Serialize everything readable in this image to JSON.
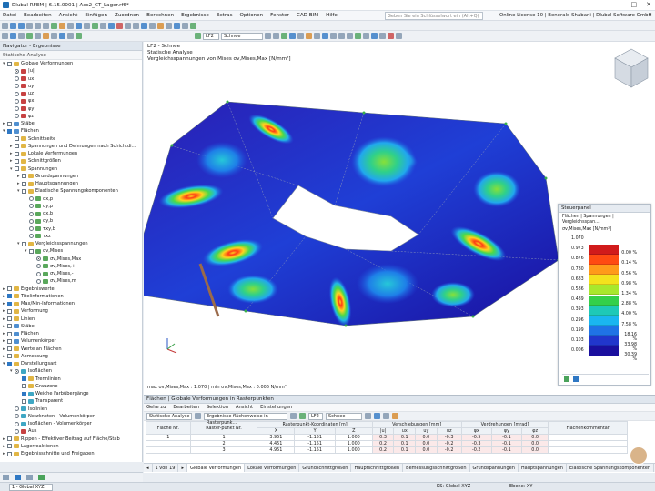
{
  "window": {
    "title": "Dlubal RFEM | 6.15.0001 | Axs2_CT_Lager.rf6*"
  },
  "menu": [
    "Datei",
    "Bearbeiten",
    "Ansicht",
    "Einfügen",
    "Zuordnen",
    "Berechnen",
    "Ergebnisse",
    "Extras",
    "Optionen",
    "Fenster",
    "CAD-BIM",
    "Hilfe"
  ],
  "search": {
    "placeholder": "Geben Sie ein Schlüsselwort ein (Alt+Q)"
  },
  "license": "Online License 10 | Benerald Shabani | Dlubal Software GmbH",
  "toolbar": {
    "loadcase_code": "LF2",
    "loadcase_name": "Schnee"
  },
  "navigator": {
    "title": "Navigator - Ergebnisse",
    "subtitle": "Statische Analyse",
    "items": [
      {
        "label": "Globale Verformungen",
        "lvl": 0,
        "ex": "▾",
        "ctl": "cb",
        "on": false,
        "ic": "y"
      },
      {
        "label": "|u|",
        "lvl": 1,
        "ex": "",
        "ctl": "rb",
        "on": true,
        "ic": "r"
      },
      {
        "label": "ux",
        "lvl": 1,
        "ex": "",
        "ctl": "rb",
        "on": false,
        "ic": "r"
      },
      {
        "label": "uy",
        "lvl": 1,
        "ex": "",
        "ctl": "rb",
        "on": false,
        "ic": "r"
      },
      {
        "label": "uz",
        "lvl": 1,
        "ex": "",
        "ctl": "rb",
        "on": false,
        "ic": "r"
      },
      {
        "label": "φx",
        "lvl": 1,
        "ex": "",
        "ctl": "rb",
        "on": false,
        "ic": "r"
      },
      {
        "label": "φy",
        "lvl": 1,
        "ex": "",
        "ctl": "rb",
        "on": false,
        "ic": "r"
      },
      {
        "label": "φz",
        "lvl": 1,
        "ex": "",
        "ctl": "rb",
        "on": false,
        "ic": "r"
      },
      {
        "label": "Stäbe",
        "lvl": 0,
        "ex": "▸",
        "ctl": "cb",
        "on": false,
        "ic": "b"
      },
      {
        "label": "Flächen",
        "lvl": 0,
        "ex": "▾",
        "ctl": "cb",
        "on": true,
        "ic": "b"
      },
      {
        "label": "Schnittseite",
        "lvl": 1,
        "ex": "",
        "ctl": "cb",
        "on": false,
        "ic": "y"
      },
      {
        "label": "Spannungen und Dehnungen nach Schichtdi...",
        "lvl": 1,
        "ex": "▸",
        "ctl": "cb",
        "on": false,
        "ic": "y"
      },
      {
        "label": "Lokale Verformungen",
        "lvl": 1,
        "ex": "▸",
        "ctl": "cb",
        "on": false,
        "ic": "y"
      },
      {
        "label": "Schnittgrößen",
        "lvl": 1,
        "ex": "▸",
        "ctl": "cb",
        "on": false,
        "ic": "y"
      },
      {
        "label": "Spannungen",
        "lvl": 1,
        "ex": "▾",
        "ctl": "cb",
        "on": false,
        "ic": "y"
      },
      {
        "label": "Grundspannungen",
        "lvl": 2,
        "ex": "▸",
        "ctl": "cb",
        "on": false,
        "ic": "y"
      },
      {
        "label": "Hauptspannungen",
        "lvl": 2,
        "ex": "▸",
        "ctl": "cb",
        "on": false,
        "ic": "y"
      },
      {
        "label": "Elastische Spannungskomponenten",
        "lvl": 2,
        "ex": "▾",
        "ctl": "cb",
        "on": false,
        "ic": "y"
      },
      {
        "label": "σx,p",
        "lvl": 3,
        "ex": "",
        "ctl": "rb",
        "on": false,
        "ic": "g"
      },
      {
        "label": "σy,p",
        "lvl": 3,
        "ex": "",
        "ctl": "rb",
        "on": false,
        "ic": "g"
      },
      {
        "label": "σx,b",
        "lvl": 3,
        "ex": "",
        "ctl": "rb",
        "on": false,
        "ic": "g"
      },
      {
        "label": "σy,b",
        "lvl": 3,
        "ex": "",
        "ctl": "rb",
        "on": false,
        "ic": "g"
      },
      {
        "label": "τxy,b",
        "lvl": 3,
        "ex": "",
        "ctl": "rb",
        "on": false,
        "ic": "g"
      },
      {
        "label": "τxz",
        "lvl": 3,
        "ex": "",
        "ctl": "rb",
        "on": false,
        "ic": "g"
      },
      {
        "label": "Vergleichsspannungen",
        "lvl": 2,
        "ex": "▾",
        "ctl": "cb",
        "on": false,
        "ic": "y"
      },
      {
        "label": "σv,Mises",
        "lvl": 3,
        "ex": "▾",
        "ctl": "cb",
        "on": false,
        "ic": "g"
      },
      {
        "label": "σv,Mises,Max",
        "lvl": 4,
        "ex": "",
        "ctl": "rb",
        "on": true,
        "ic": "g"
      },
      {
        "label": "σv,Mises,+",
        "lvl": 4,
        "ex": "",
        "ctl": "rb",
        "on": false,
        "ic": "g"
      },
      {
        "label": "σv,Mises,-",
        "lvl": 4,
        "ex": "",
        "ctl": "rb",
        "on": false,
        "ic": "g"
      },
      {
        "label": "σv,Mises,m",
        "lvl": 4,
        "ex": "",
        "ctl": "rb",
        "on": false,
        "ic": "g"
      },
      {
        "label": "Ergebniswerte",
        "lvl": 0,
        "ex": "▸",
        "ctl": "cb",
        "on": false,
        "ic": "y"
      },
      {
        "label": "Titelinformationen",
        "lvl": 0,
        "ex": "▸",
        "ctl": "cb",
        "on": true,
        "ic": "y"
      },
      {
        "label": "Max/Min-Informationen",
        "lvl": 0,
        "ex": "▸",
        "ctl": "cb",
        "on": true,
        "ic": "y"
      },
      {
        "label": "Verformung",
        "lvl": 0,
        "ex": "▸",
        "ctl": "cb",
        "on": false,
        "ic": "y"
      },
      {
        "label": "Linien",
        "lvl": 0,
        "ex": "▸",
        "ctl": "cb",
        "on": false,
        "ic": "y"
      },
      {
        "label": "Stäbe",
        "lvl": 0,
        "ex": "▸",
        "ctl": "cb",
        "on": false,
        "ic": "b"
      },
      {
        "label": "Flächen",
        "lvl": 0,
        "ex": "▸",
        "ctl": "cb",
        "on": false,
        "ic": "b"
      },
      {
        "label": "Volumenkörper",
        "lvl": 0,
        "ex": "▸",
        "ctl": "cb",
        "on": false,
        "ic": "b"
      },
      {
        "label": "Werte an Flächen",
        "lvl": 0,
        "ex": "▸",
        "ctl": "cb",
        "on": false,
        "ic": "y"
      },
      {
        "label": "Abmessung",
        "lvl": 0,
        "ex": "▸",
        "ctl": "cb",
        "on": false,
        "ic": "y"
      },
      {
        "label": "Darstellungsart",
        "lvl": 0,
        "ex": "▾",
        "ctl": "cb",
        "on": true,
        "ic": "y"
      },
      {
        "label": "Isoflächen",
        "lvl": 1,
        "ex": "▾",
        "ctl": "rb",
        "on": true,
        "ic": "c"
      },
      {
        "label": "Trennlinien",
        "lvl": 2,
        "ex": "",
        "ctl": "cb",
        "on": true,
        "ic": "y"
      },
      {
        "label": "Grauzone",
        "lvl": 2,
        "ex": "",
        "ctl": "cb",
        "on": false,
        "ic": "y"
      },
      {
        "label": "Weiche Farbübergänge",
        "lvl": 2,
        "ex": "",
        "ctl": "cb",
        "on": true,
        "ic": "c"
      },
      {
        "label": "Transparent",
        "lvl": 2,
        "ex": "",
        "ctl": "cb",
        "on": false,
        "ic": "c"
      },
      {
        "label": "Isolinien",
        "lvl": 1,
        "ex": "",
        "ctl": "rb",
        "on": false,
        "ic": "c"
      },
      {
        "label": "Netzknoten - Volumenkörper",
        "lvl": 1,
        "ex": "",
        "ctl": "rb",
        "on": false,
        "ic": "c"
      },
      {
        "label": "Isoflächen - Volumenkörper",
        "lvl": 1,
        "ex": "",
        "ctl": "rb",
        "on": false,
        "ic": "c"
      },
      {
        "label": "Aus",
        "lvl": 1,
        "ex": "",
        "ctl": "rb",
        "on": false,
        "ic": "r"
      },
      {
        "label": "Rippen - Effektiver Beitrag auf Fläche/Stab",
        "lvl": 0,
        "ex": "▸",
        "ctl": "cb",
        "on": false,
        "ic": "y"
      },
      {
        "label": "Lagerreaktionen",
        "lvl": 0,
        "ex": "▸",
        "ctl": "cb",
        "on": false,
        "ic": "y"
      },
      {
        "label": "Ergebnisschnitte und Freigaben",
        "lvl": 0,
        "ex": "▸",
        "ctl": "cb",
        "on": false,
        "ic": "y"
      }
    ]
  },
  "nav_bottom": {
    "view_select": "1 - Global XYZ"
  },
  "view": {
    "line1": "LF2 - Schnee",
    "line2": "Statische Analyse",
    "line3": "Vergleichsspannungen von Mises σv,Mises,Max [N/mm²]",
    "footer": "max σv,Mises,Max : 1.070 | min σv,Mises,Max : 0.006 N/mm²"
  },
  "control_panel": {
    "title": "Steuerpanel",
    "subtitle": "Flächen | Spannungen | Vergleichsspan...",
    "unit": "σv,Mises,Max [N/mm²]",
    "legend": [
      {
        "value": "1.070",
        "color": "#7a0a0a",
        "pct": ""
      },
      {
        "value": "0.973",
        "color": "#d11b1b",
        "pct": "0.00 %"
      },
      {
        "value": "0.876",
        "color": "#ff4a12",
        "pct": "0.14 %"
      },
      {
        "value": "0.780",
        "color": "#ff9a1a",
        "pct": "0.56 %"
      },
      {
        "value": "0.683",
        "color": "#f3e21d",
        "pct": "0.98 %"
      },
      {
        "value": "0.586",
        "color": "#a7e82d",
        "pct": "1.34 %"
      },
      {
        "value": "0.489",
        "color": "#33d04a",
        "pct": "2.88 %"
      },
      {
        "value": "0.393",
        "color": "#1ec9b7",
        "pct": "4.00 %"
      },
      {
        "value": "0.296",
        "color": "#1ab6f0",
        "pct": "7.58 %"
      },
      {
        "value": "0.199",
        "color": "#1f73e6",
        "pct": "18.16 %"
      },
      {
        "value": "0.103",
        "color": "#2136cc",
        "pct": "33.98 %"
      },
      {
        "value": "0.006",
        "color": "#1a0f9e",
        "pct": "30.39 %"
      }
    ]
  },
  "table": {
    "title": "Flächen | Globale Verformungen in Rasterpunkten",
    "menu": [
      "Gehe zu",
      "Bearbeiten",
      "Selektion",
      "Ansicht",
      "Einstellungen"
    ],
    "analysis_select": "Statische Analyse",
    "results_select": "Ergebnisse flächenweise in Rasterpunk...",
    "lc_code": "LF2",
    "lc_name": "Schnee",
    "header1": [
      "Fläche Nr.",
      "Raster-punkt Nr.",
      "Rasterpunkt-Koordinaten [m]",
      "Verschiebungen [mm]",
      "Verdrehungen [mrad]",
      "Flächenkommentar"
    ],
    "header2": [
      "X",
      "Y",
      "Z",
      "|u|",
      "ux",
      "uy",
      "uz",
      "φx",
      "φy",
      "φz"
    ],
    "rows": [
      [
        "1",
        "1",
        "3.951",
        "-1.151",
        "1.000",
        "0.3",
        "0.1",
        "0.0",
        "-0.3",
        "-0.5",
        "-0.1",
        "0.0",
        ""
      ],
      [
        "",
        "2",
        "4.451",
        "-1.151",
        "1.000",
        "0.2",
        "0.1",
        "0.0",
        "-0.2",
        "-0.3",
        "-0.1",
        "0.0",
        ""
      ],
      [
        "",
        "3",
        "4.951",
        "-1.151",
        "1.000",
        "0.2",
        "0.1",
        "0.0",
        "-0.2",
        "-0.2",
        "-0.1",
        "0.0",
        ""
      ]
    ],
    "pager": "1 von 19"
  },
  "tabs": [
    "Globale Verformungen",
    "Lokale Verformungen",
    "Grundschnittgrößen",
    "Hauptschnittgrößen",
    "Bemessungsschnittgrößen",
    "Grundspannungen",
    "Hauptspannungen",
    "Elastische Spannungskomponenten"
  ],
  "status": {
    "ks": "KS: Global XYZ",
    "plane": "Ebene: XY"
  }
}
